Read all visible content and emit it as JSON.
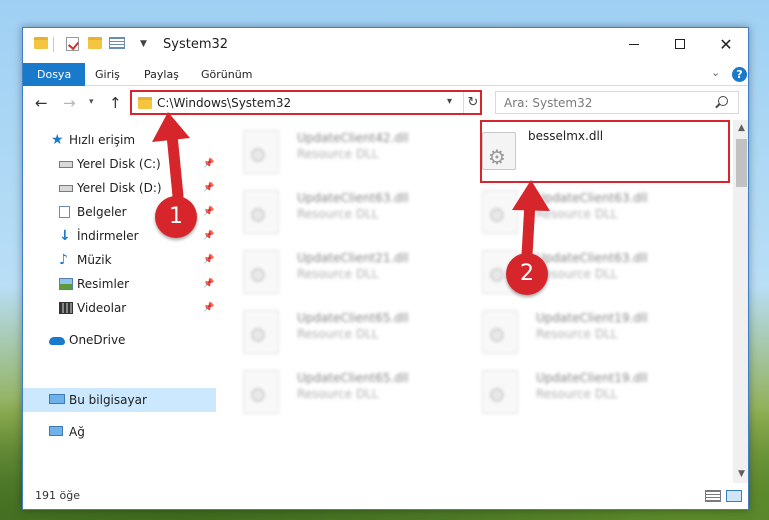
{
  "window": {
    "title": "System32",
    "controls": {
      "minimize": "—",
      "maximize": "☐",
      "close": "✕"
    }
  },
  "ribbon": {
    "tabs": [
      "Dosya",
      "Giriş",
      "Paylaş",
      "Görünüm"
    ],
    "collapse_icon": "chevron-down-icon",
    "help": "?"
  },
  "address_bar": {
    "path": "C:\\Windows\\System32",
    "dropdown": "⌄",
    "refresh": "↻"
  },
  "nav_buttons": {
    "back": "←",
    "forward": "→",
    "recent": "⌄",
    "up": "↑"
  },
  "search": {
    "placeholder": "Ara: System32"
  },
  "nav_pane": {
    "items": [
      {
        "label": "Hızlı erişim",
        "icon": "star-icon",
        "pinned": false
      },
      {
        "label": "Yerel Disk (C:)",
        "icon": "drive-icon",
        "pinned": true
      },
      {
        "label": "Yerel Disk (D:)",
        "icon": "drive-icon",
        "pinned": true
      },
      {
        "label": "Belgeler",
        "icon": "documents-icon",
        "pinned": true
      },
      {
        "label": "İndirmeler",
        "icon": "downloads-icon",
        "pinned": true
      },
      {
        "label": "Müzik",
        "icon": "music-icon",
        "pinned": true
      },
      {
        "label": "Resimler",
        "icon": "pictures-icon",
        "pinned": true
      },
      {
        "label": "Videolar",
        "icon": "videos-icon",
        "pinned": true
      },
      {
        "label": "OneDrive",
        "icon": "cloud-icon",
        "pinned": false
      },
      {
        "label": "Bu bilgisayar",
        "icon": "computer-icon",
        "pinned": false,
        "selected": true
      },
      {
        "label": "Ağ",
        "icon": "network-icon",
        "pinned": false
      }
    ],
    "pin_glyph": "📌"
  },
  "files": {
    "highlighted": {
      "name": "besselmx.dll",
      "type": ""
    },
    "left_column": [
      {
        "name": "UpdateClient42.dll",
        "type": "Resource DLL"
      },
      {
        "name": "UpdateClient63.dll",
        "type": "Resource DLL"
      },
      {
        "name": "UpdateClient21.dll",
        "type": "Resource DLL"
      },
      {
        "name": "UpdateClient65.dll",
        "type": "Resource DLL"
      },
      {
        "name": "UpdateClient65.dll",
        "type": "Resource DLL"
      }
    ],
    "right_column": [
      {
        "name": "UpdateClient63.dll",
        "type": "Resource DLL"
      },
      {
        "name": "UpdateClient63.dll",
        "type": "Resource DLL"
      },
      {
        "name": "UpdateClient19.dll",
        "type": "Resource DLL"
      },
      {
        "name": "UpdateClient19.dll",
        "type": "Resource DLL"
      }
    ]
  },
  "status_bar": {
    "item_count": "191 öğe"
  },
  "annotations": {
    "step1": "1",
    "step2": "2",
    "color": "#d6262c"
  }
}
